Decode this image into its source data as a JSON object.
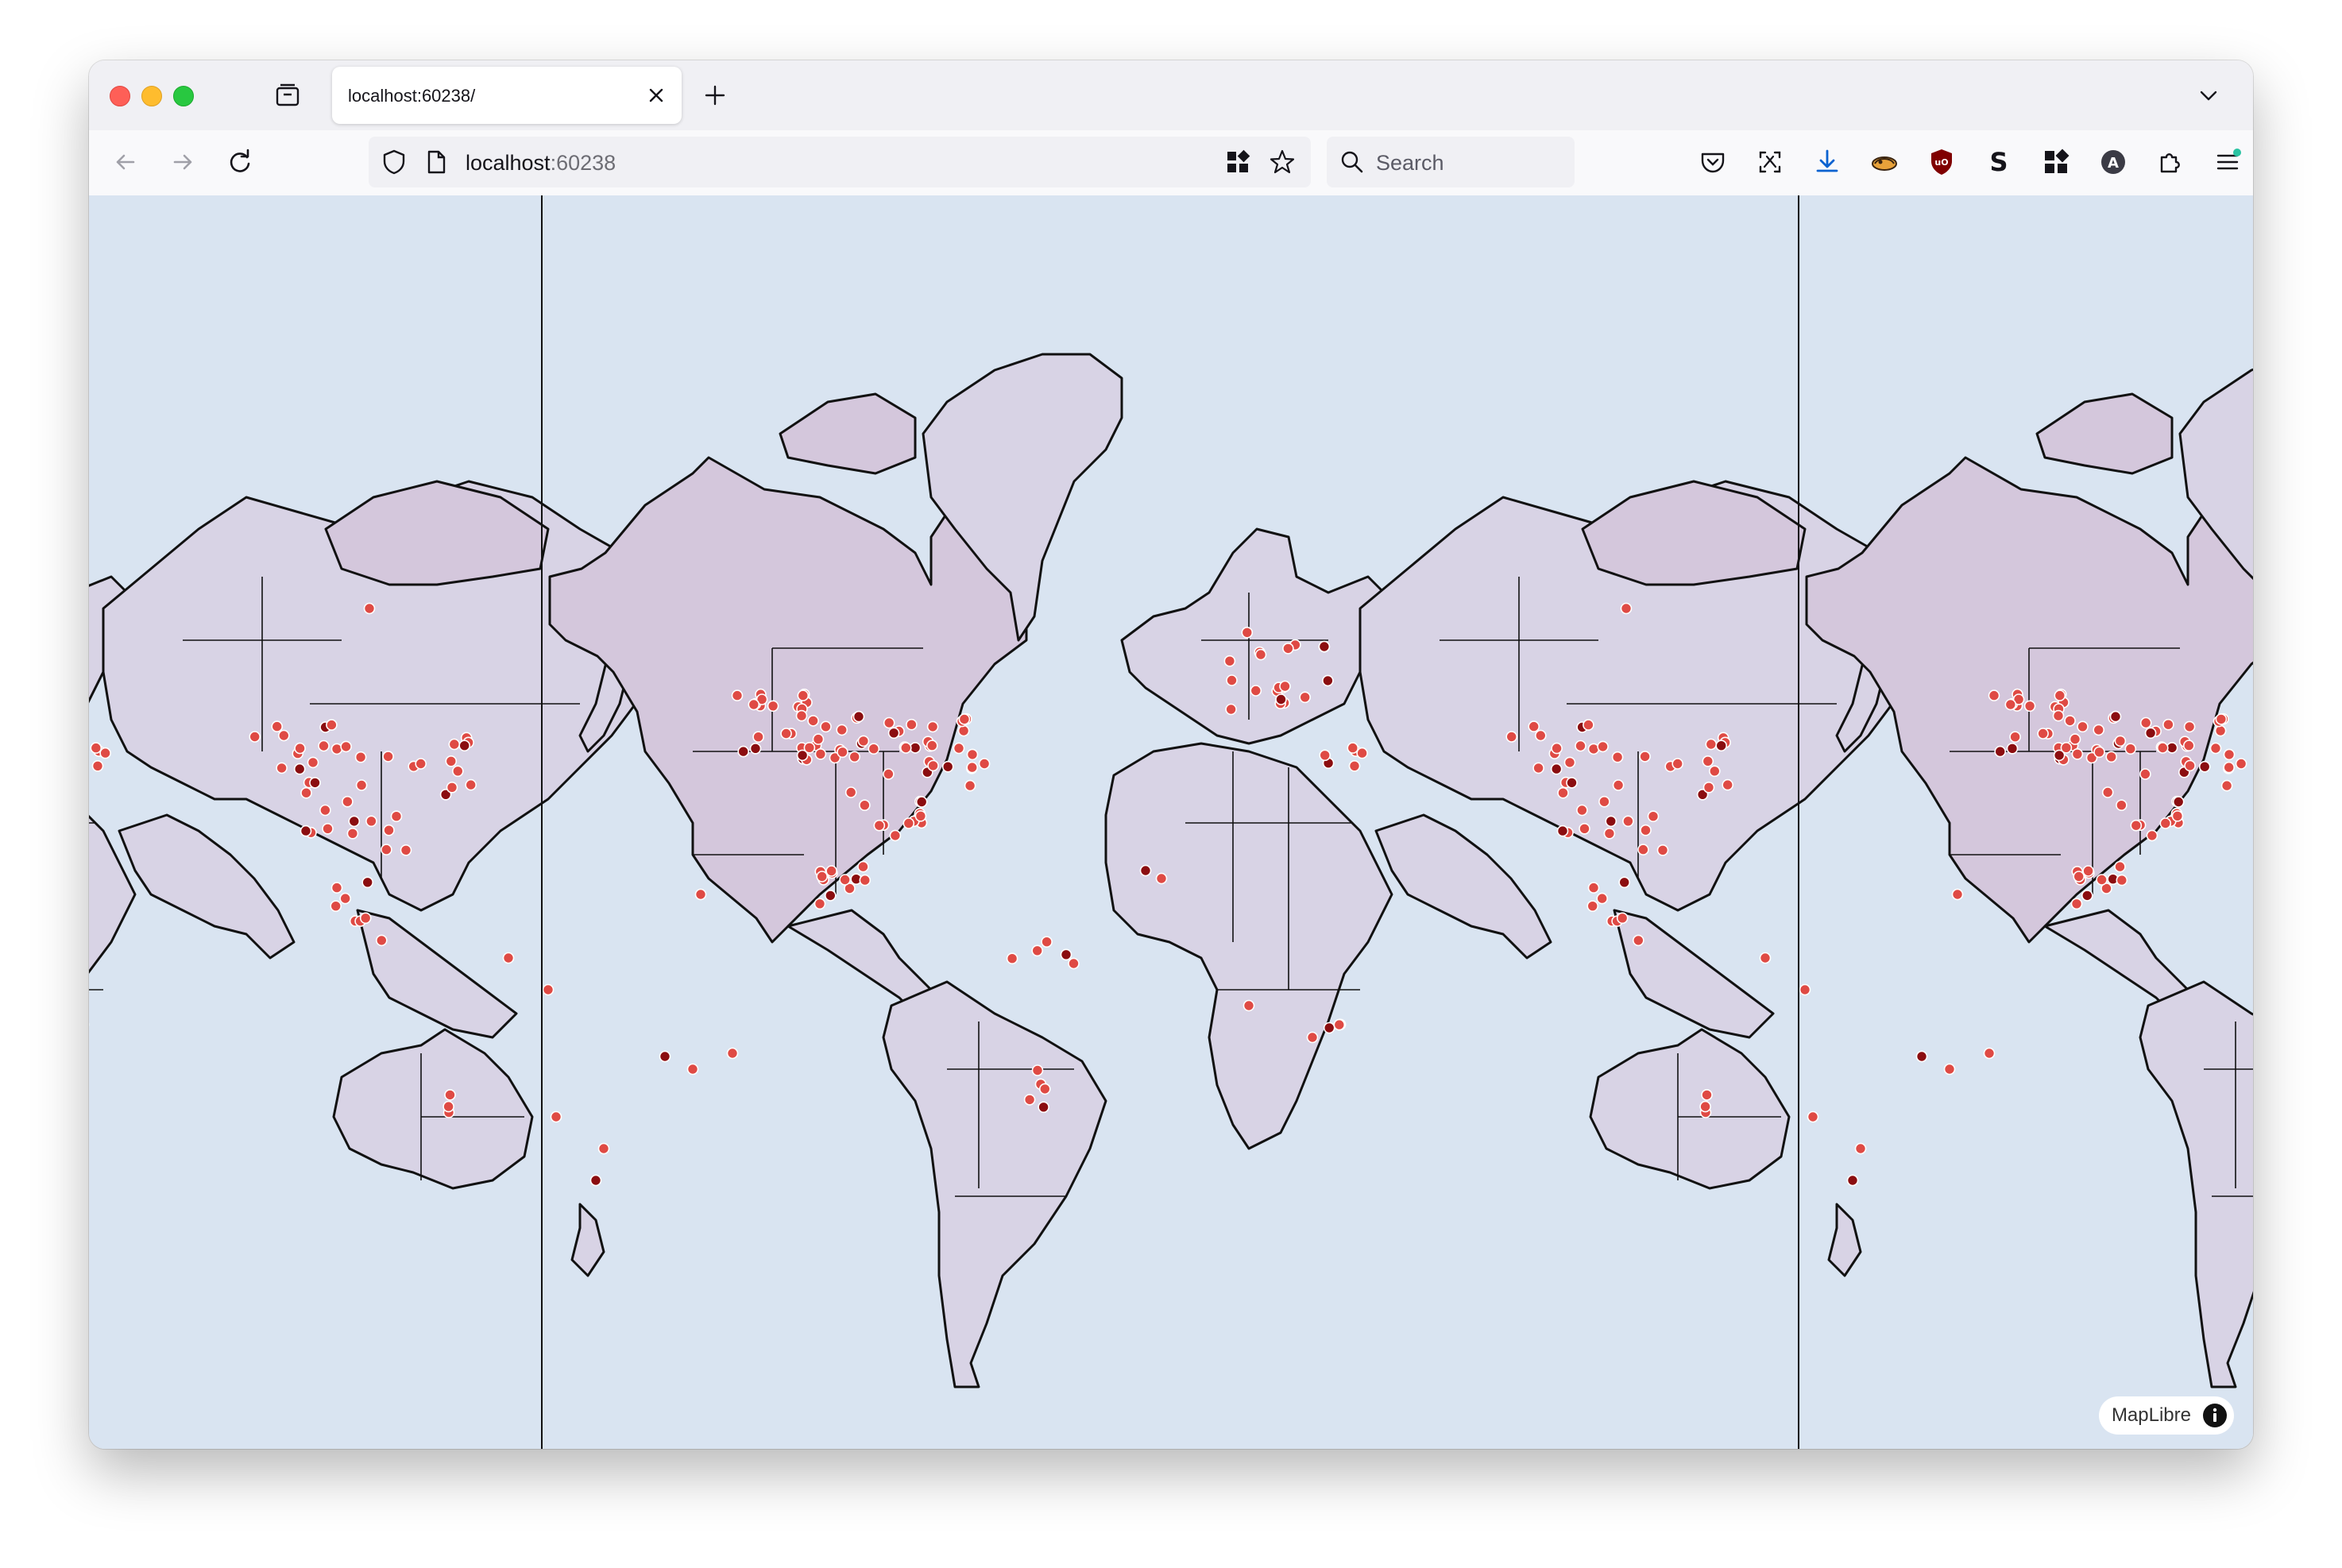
{
  "browser": {
    "tab": {
      "title": "localhost:60238/"
    },
    "url": {
      "host": "localhost",
      "port": ":60238"
    },
    "search": {
      "placeholder": "Search"
    }
  },
  "map": {
    "attribution": "MapLibre",
    "colors": {
      "water": "#d9e4f1",
      "land": "#d8d3e5",
      "highlighted_land": "#d4c7dc",
      "border": "#111111",
      "marker_fill": "#df4a44",
      "marker_dark": "#8b0d10",
      "marker_stroke": "#ffffff"
    },
    "world_copies": 3
  },
  "icons": {
    "tab_list": "tab-list-icon",
    "tab_close": "close-icon",
    "new_tab": "plus-icon",
    "list_all_tabs": "chevron-down-icon",
    "back": "arrow-left-icon",
    "forward": "arrow-right-icon",
    "reload": "reload-icon",
    "tracking_protection": "shield-icon",
    "page_info": "page-icon",
    "extensions_grid": "grid-icon",
    "bookmark": "star-icon",
    "search": "search-icon",
    "pocket": "pocket-icon",
    "screenshot": "screenshot-icon",
    "downloads": "download-icon",
    "ublock": "ublock-icon",
    "account": "account-icon",
    "puzzle": "puzzle-icon",
    "menu": "hamburger-menu-icon",
    "info": "info-icon"
  }
}
